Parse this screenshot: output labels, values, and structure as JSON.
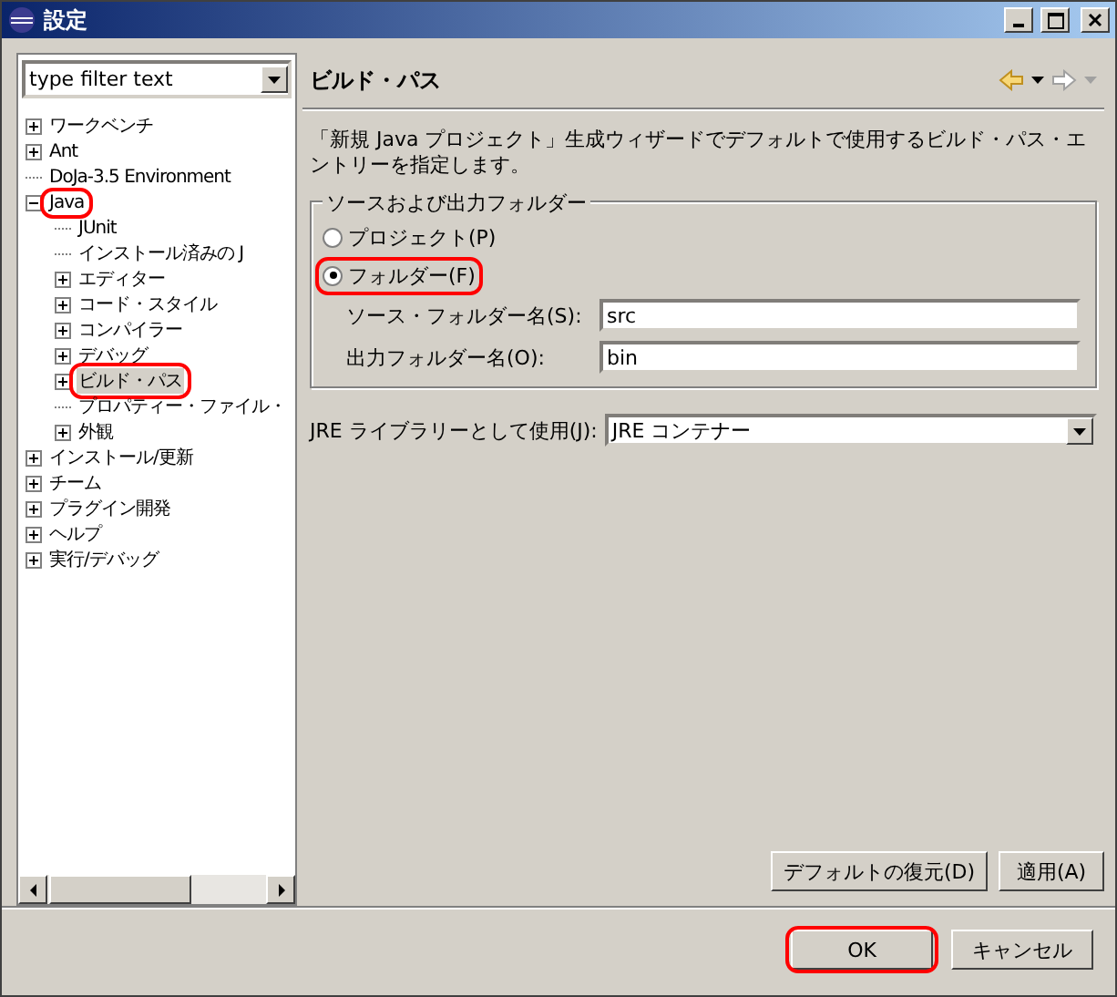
{
  "window": {
    "title": "設定"
  },
  "filter": {
    "value": "type filter text"
  },
  "tree": [
    {
      "label": "ワークベンチ",
      "expanded": false,
      "selected": false,
      "annotated": false
    },
    {
      "label": "Ant",
      "expanded": false,
      "selected": false,
      "annotated": false
    },
    {
      "label": "DoJa-3.5 Environment",
      "selected": false,
      "annotated": false
    },
    {
      "label": "Java",
      "expanded": true,
      "selected": false,
      "annotated": true,
      "children": [
        {
          "label": "JUnit",
          "selected": false,
          "annotated": false
        },
        {
          "label": "インストール済みの J",
          "selected": false,
          "annotated": false
        },
        {
          "label": "エディター",
          "expanded": false,
          "selected": false,
          "annotated": false
        },
        {
          "label": "コード・スタイル",
          "expanded": false,
          "selected": false,
          "annotated": false
        },
        {
          "label": "コンパイラー",
          "expanded": false,
          "selected": false,
          "annotated": false
        },
        {
          "label": "デバッグ",
          "expanded": false,
          "selected": false,
          "annotated": false
        },
        {
          "label": "ビルド・パス",
          "expanded": false,
          "selected": true,
          "annotated": true
        },
        {
          "label": "プロパティー・ファイル・",
          "selected": false,
          "annotated": false
        },
        {
          "label": "外観",
          "expanded": false,
          "selected": false,
          "annotated": false
        }
      ]
    },
    {
      "label": "インストール/更新",
      "expanded": false,
      "selected": false,
      "annotated": false
    },
    {
      "label": "チーム",
      "expanded": false,
      "selected": false,
      "annotated": false
    },
    {
      "label": "プラグイン開発",
      "expanded": false,
      "selected": false,
      "annotated": false
    },
    {
      "label": "ヘルプ",
      "expanded": false,
      "selected": false,
      "annotated": false
    },
    {
      "label": "実行/デバッグ",
      "expanded": false,
      "selected": false,
      "annotated": false
    }
  ],
  "page": {
    "title": "ビルド・パス",
    "description": "「新規 Java プロジェクト」生成ウィザードでデフォルトで使用するビルド・パス・エントリーを指定します。",
    "group": {
      "title": "ソースおよび出力フォルダー",
      "options": [
        {
          "label": "プロジェクト(P)",
          "selected": false,
          "annotated": false
        },
        {
          "label": "フォルダー(F)",
          "selected": true,
          "annotated": true
        }
      ],
      "fields": [
        {
          "label": "ソース・フォルダー名(S):",
          "value": "src"
        },
        {
          "label": "出力フォルダー名(O):",
          "value": "bin"
        }
      ]
    },
    "jre": {
      "label": "JRE ライブラリーとして使用(J):",
      "value": "JRE コンテナー"
    },
    "buttons": [
      "デフォルトの復元(D)",
      "適用(A)"
    ]
  },
  "buttons": [
    {
      "label": "OK",
      "annotated": true
    },
    {
      "label": "キャンセル",
      "annotated": false
    }
  ]
}
